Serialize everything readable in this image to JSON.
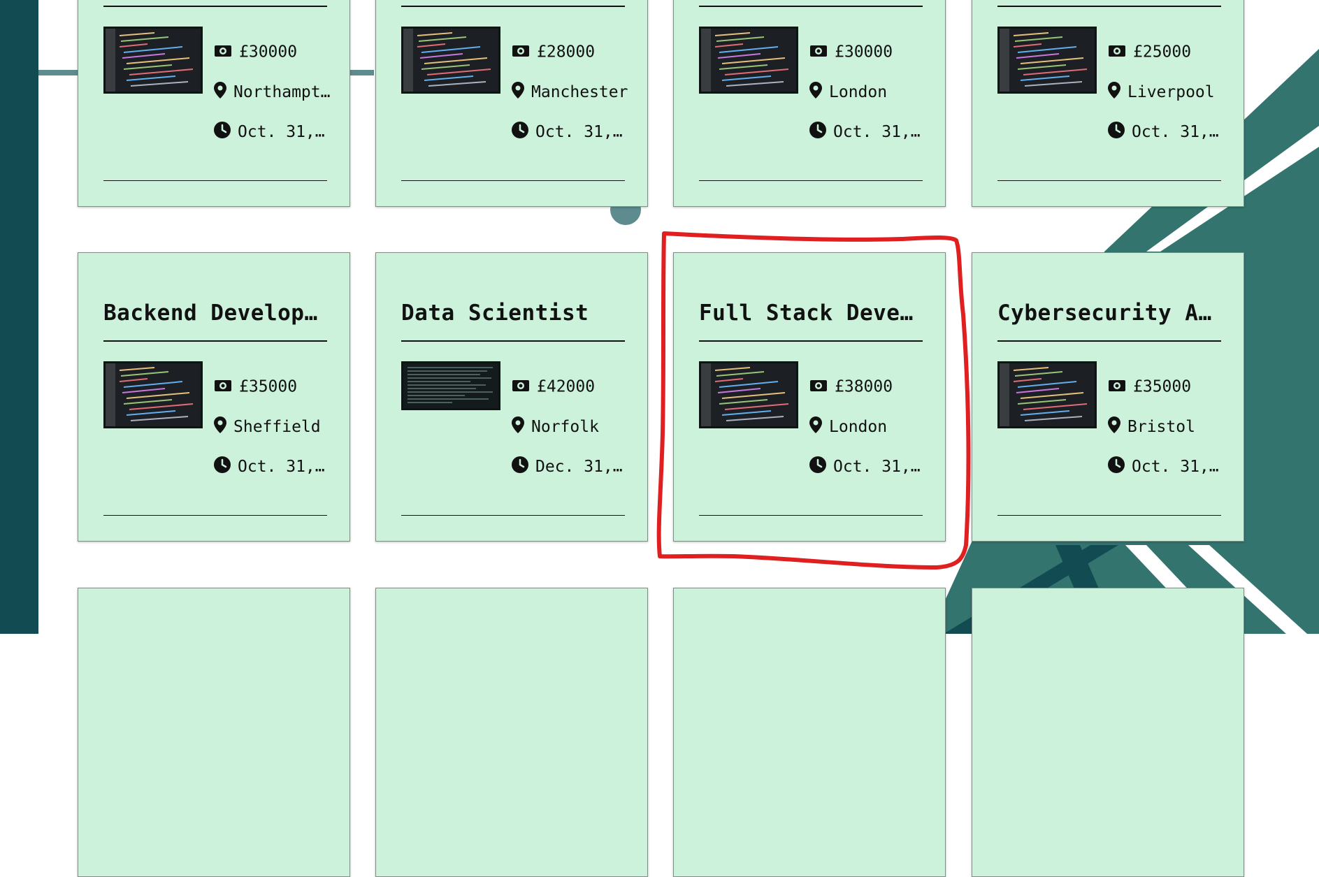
{
  "colors": {
    "card_bg": "#ccf2dc",
    "accent_dark": "#124c52",
    "deco_teal": "#33746f",
    "highlight_red": "#e02020"
  },
  "rows": [
    {
      "cards": [
        {
          "title": "",
          "salary": "£30000",
          "location": "Northampt…",
          "date": "Oct. 31, …"
        },
        {
          "title": "",
          "salary": "£28000",
          "location": "Manchester",
          "date": "Oct. 31, …"
        },
        {
          "title": "",
          "salary": "£30000",
          "location": "London",
          "date": "Oct. 31, …"
        },
        {
          "title": "",
          "salary": "£25000",
          "location": "Liverpool",
          "date": "Oct. 31, …"
        }
      ]
    },
    {
      "cards": [
        {
          "title": "Backend Developer",
          "salary": "£35000",
          "location": "Sheffield",
          "date": "Oct. 31, …"
        },
        {
          "title": "Data Scientist",
          "salary": "£42000",
          "location": "Norfolk",
          "date": "Dec. 31, …"
        },
        {
          "title": "Full Stack Devel…",
          "salary": "£38000",
          "location": "London",
          "date": "Oct. 31, …"
        },
        {
          "title": "Cybersecurity An…",
          "salary": "£35000",
          "location": "Bristol",
          "date": "Oct. 31, …"
        }
      ]
    }
  ],
  "icons": {
    "salary": "money-icon",
    "location": "location-pin-icon",
    "date": "clock-icon"
  }
}
